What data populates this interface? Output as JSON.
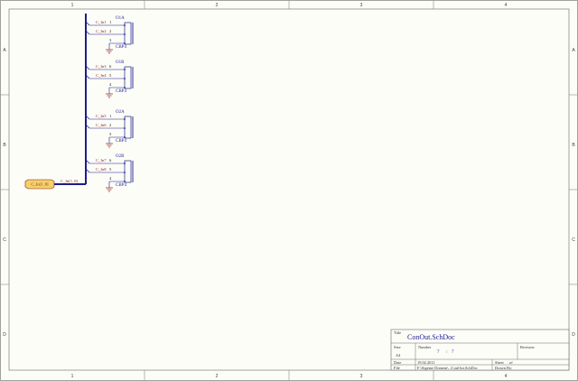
{
  "sheet": {
    "border_color": "#8a8a8a",
    "paper_color": "#fdfdf8",
    "wire_color": "#1c1c8c",
    "pin_color": "#8b1a1a",
    "zone_columns": [
      "1",
      "2",
      "3",
      "4"
    ],
    "zone_rows": [
      "A",
      "B",
      "C",
      "D"
    ]
  },
  "bus": {
    "port_label": "C_In[1..8]",
    "bus_label": "C_In[1..8]"
  },
  "connectors": [
    {
      "ref": "O1A",
      "part": "CBP4",
      "pins": [
        {
          "net": "C_In1",
          "num": "1"
        },
        {
          "net": "C_In2",
          "num": "2"
        }
      ],
      "gnd_pin": "3"
    },
    {
      "ref": "O1B",
      "part": "CBP4",
      "pins": [
        {
          "net": "C_In3",
          "num": "6"
        },
        {
          "net": "C_In4",
          "num": "5"
        }
      ],
      "gnd_pin": "4"
    },
    {
      "ref": "O2A",
      "part": "CBP4",
      "pins": [
        {
          "net": "C_In5",
          "num": "1"
        },
        {
          "net": "C_In6",
          "num": "2"
        }
      ],
      "gnd_pin": "3"
    },
    {
      "ref": "O2B",
      "part": "CBP4",
      "pins": [
        {
          "net": "C_In7",
          "num": "6"
        },
        {
          "net": "C_In8",
          "num": "5"
        }
      ],
      "gnd_pin": "4"
    }
  ],
  "title_block": {
    "title_label": "Title",
    "title": "ConOut.SchDoc",
    "size_label": "Size",
    "size": "A4",
    "number_label": "Number",
    "sheet_number": "7",
    "sheet_total": "7",
    "sheet_sep": "/",
    "revision_label": "Revision",
    "date_label": "Date",
    "date": "19.02.2011",
    "sheet_label": "Sheet",
    "of_label": "of",
    "file_label": "File",
    "file": "F:\\Sigeme Domeni\\..\\ConOut.SchDoc",
    "drawn_label": "Drawn By:"
  }
}
